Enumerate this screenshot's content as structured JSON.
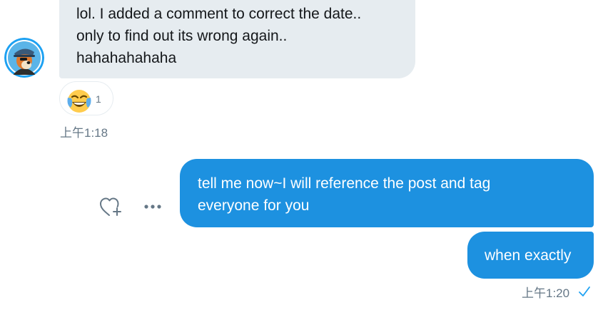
{
  "conversation": {
    "incoming": {
      "lines": [
        "lol. I added a comment to correct the date..",
        "only to find out its wrong again..",
        "hahahahahaha"
      ],
      "reaction": {
        "emoji": "joy-emoji",
        "count": "1"
      },
      "time": "上午1:18"
    },
    "outgoing": {
      "first_lines": [
        "tell me now~I will reference the post and tag",
        "everyone for you"
      ],
      "second": "when exactly",
      "time": "上午1:20",
      "status_icon": "check-icon"
    }
  },
  "colors": {
    "outgoing_bubble": "#1d91e0",
    "incoming_bubble": "#e6ecf0",
    "muted_text": "#657786",
    "accent": "#1da1f2"
  },
  "icons": {
    "like": "heart-plus-icon",
    "more": "more-icon"
  }
}
